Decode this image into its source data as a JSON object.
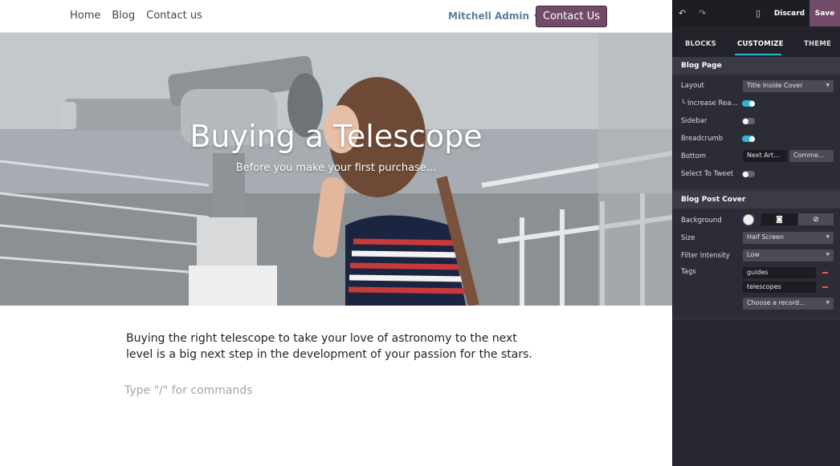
{
  "site": {
    "nav": {
      "links": [
        "Home",
        "Blog",
        "Contact us"
      ]
    },
    "user": "Mitchell Admin",
    "cta_label": "Contact Us",
    "cover": {
      "title": "Buying a Telescope",
      "subtitle": "Before you make your first purchase..."
    },
    "body_text": "Buying the right telescope to take your love of astronomy to the next level is a big next step in the development of your passion for the stars.",
    "editor_placeholder": "Type \"/\" for commands"
  },
  "editor": {
    "discard_label": "Discard",
    "save_label": "Save",
    "tabs": [
      "BLOCKS",
      "CUSTOMIZE",
      "THEME"
    ],
    "active_tab": "CUSTOMIZE",
    "blog_page": {
      "title": "Blog Page",
      "layout_label": "Layout",
      "layout_value": "Title Inside Cover",
      "increase_label": "└ Increase Rea...",
      "increase_on": true,
      "sidebar_label": "Sidebar",
      "sidebar_on": false,
      "breadcrumb_label": "Breadcrumb",
      "breadcrumb_on": true,
      "bottom_label": "Bottom",
      "bottom_options": [
        "Next Art...",
        "Comme..."
      ],
      "tweet_label": "Select To Tweet",
      "tweet_on": false
    },
    "cover": {
      "title": "Blog Post Cover",
      "background_label": "Background",
      "background_color": "#f0f0f0",
      "size_label": "Size",
      "size_value": "Half Screen",
      "filter_label": "Filter Intensity",
      "filter_value": "Low",
      "tags_label": "Tags",
      "tags": [
        "guides",
        "telescopes"
      ],
      "choose_placeholder": "Choose a record..."
    },
    "colors": {
      "accent": "#2fb5d3",
      "brand": "#714b67",
      "remove": "#e25b61"
    }
  }
}
